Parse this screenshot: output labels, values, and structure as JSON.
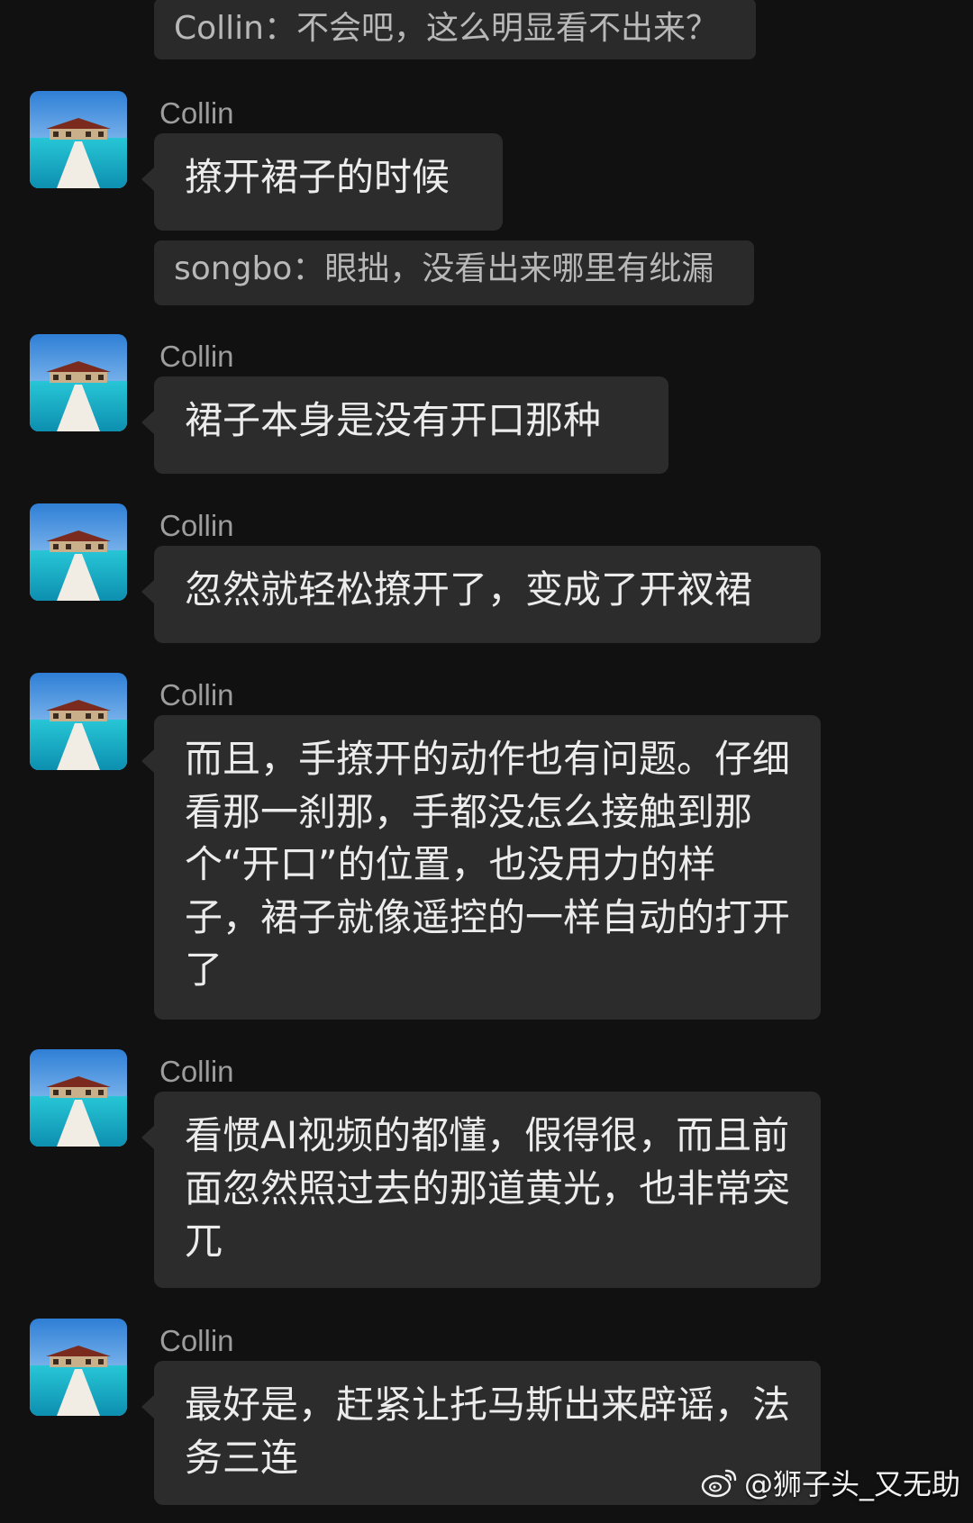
{
  "quotes": [
    "Collin：不会吧，这么明显看不出来？",
    "songbo：眼拙，没看出来哪里有纰漏"
  ],
  "messages": [
    {
      "sender": "Collin",
      "text": "撩开裙子的时候"
    },
    {
      "sender": "Collin",
      "text": "裙子本身是没有开口那种"
    },
    {
      "sender": "Collin",
      "text": "忽然就轻松撩开了，变成了开衩裙"
    },
    {
      "sender": "Collin",
      "text": "而且，手撩开的动作也有问题。仔细看那一刹那，手都没怎么接触到那个“开口”的位置，也没用力的样子，裙子就像遥控的一样自动的打开了"
    },
    {
      "sender": "Collin",
      "text": "看惯AI视频的都懂，假得很，而且前面忽然照过去的那道黄光，也非常突兀"
    },
    {
      "sender": "Collin",
      "text": "最好是，赶紧让托马斯出来辟谣，法务三连"
    }
  ],
  "avatar": {
    "icon": "resort-pier-avatar-icon"
  },
  "watermark": {
    "icon": "weibo-icon",
    "text": "@狮子头_又无助"
  },
  "colors": {
    "background": "#111111",
    "bubble": "#2c2c2c",
    "quote": "#2a2a2a",
    "sender": "#9d9d9d",
    "text": "#ececec"
  }
}
